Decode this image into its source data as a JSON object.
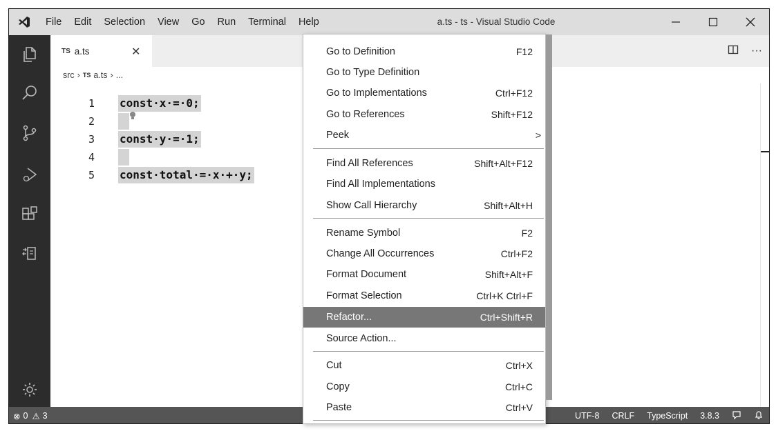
{
  "titlebar": {
    "menus": [
      "File",
      "Edit",
      "Selection",
      "View",
      "Go",
      "Run",
      "Terminal",
      "Help"
    ],
    "title": "a.ts - ts - Visual Studio Code"
  },
  "tab": {
    "label": "a.ts",
    "badge": "TS"
  },
  "breadcrumb": [
    "src",
    "TS",
    "a.ts",
    "..."
  ],
  "code": [
    {
      "no": "1",
      "text": "const·x·=·0;"
    },
    {
      "no": "2",
      "text": ""
    },
    {
      "no": "3",
      "text": "const·y·=·1;"
    },
    {
      "no": "4",
      "text": ""
    },
    {
      "no": "5",
      "text": "const·total·=·x·+·y;"
    }
  ],
  "context_menu": {
    "items": [
      {
        "label": "Go to Definition",
        "kbd": "F12"
      },
      {
        "label": "Go to Type Definition",
        "kbd": ""
      },
      {
        "label": "Go to Implementations",
        "kbd": "Ctrl+F12"
      },
      {
        "label": "Go to References",
        "kbd": "Shift+F12"
      },
      {
        "label": "Peek",
        "kbd": ">"
      },
      {
        "label": "Find All References",
        "kbd": "Shift+Alt+F12"
      },
      {
        "label": "Find All Implementations",
        "kbd": ""
      },
      {
        "label": "Show Call Hierarchy",
        "kbd": "Shift+Alt+H"
      },
      {
        "label": "Rename Symbol",
        "kbd": "F2"
      },
      {
        "label": "Change All Occurrences",
        "kbd": "Ctrl+F2"
      },
      {
        "label": "Format Document",
        "kbd": "Shift+Alt+F"
      },
      {
        "label": "Format Selection",
        "kbd": "Ctrl+K Ctrl+F"
      },
      {
        "label": "Refactor...",
        "kbd": "Ctrl+Shift+R"
      },
      {
        "label": "Source Action...",
        "kbd": ""
      },
      {
        "label": "Cut",
        "kbd": "Ctrl+X"
      },
      {
        "label": "Copy",
        "kbd": "Ctrl+C"
      },
      {
        "label": "Paste",
        "kbd": "Ctrl+V"
      }
    ]
  },
  "statusbar": {
    "errors": "0",
    "warnings": "3",
    "encoding": "UTF-8",
    "eol": "CRLF",
    "language": "TypeScript",
    "version": "3.8.3"
  },
  "colors": {
    "titlebar": "#dddddd",
    "activitybar": "#2c2c2c",
    "statusbar": "#555555",
    "menu_active": "#777777",
    "selection": "#d4d4d4"
  }
}
